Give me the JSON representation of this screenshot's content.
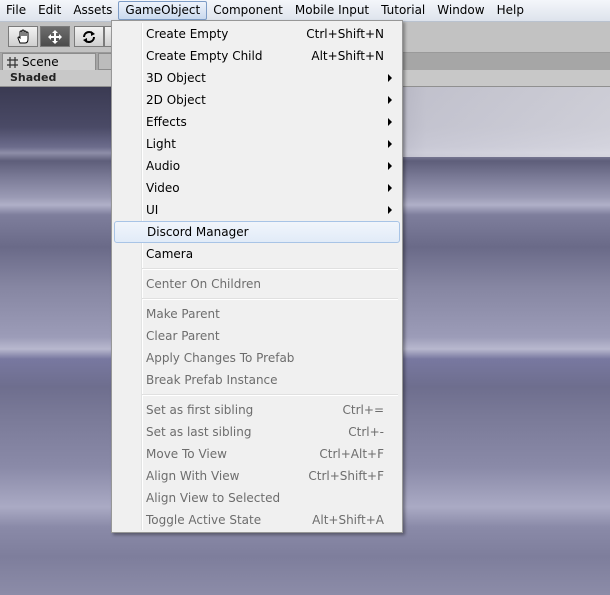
{
  "menubar": {
    "items": [
      "File",
      "Edit",
      "Assets",
      "GameObject",
      "Component",
      "Mobile Input",
      "Tutorial",
      "Window",
      "Help"
    ],
    "active": "GameObject"
  },
  "toolbar": {
    "tools": [
      "hand-icon",
      "move-icon",
      "rotate-icon"
    ]
  },
  "panel": {
    "tab_label": "Scene",
    "shading_mode": "Shaded"
  },
  "menu": {
    "groups": [
      [
        {
          "label": "Create Empty",
          "shortcut": "Ctrl+Shift+N",
          "submenu": false,
          "enabled": true
        },
        {
          "label": "Create Empty Child",
          "shortcut": "Alt+Shift+N",
          "submenu": false,
          "enabled": true
        },
        {
          "label": "3D Object",
          "shortcut": "",
          "submenu": true,
          "enabled": true
        },
        {
          "label": "2D Object",
          "shortcut": "",
          "submenu": true,
          "enabled": true
        },
        {
          "label": "Effects",
          "shortcut": "",
          "submenu": true,
          "enabled": true
        },
        {
          "label": "Light",
          "shortcut": "",
          "submenu": true,
          "enabled": true
        },
        {
          "label": "Audio",
          "shortcut": "",
          "submenu": true,
          "enabled": true
        },
        {
          "label": "Video",
          "shortcut": "",
          "submenu": true,
          "enabled": true
        },
        {
          "label": "UI",
          "shortcut": "",
          "submenu": true,
          "enabled": true
        },
        {
          "label": "Discord Manager",
          "shortcut": "",
          "submenu": false,
          "enabled": true,
          "highlighted": true
        },
        {
          "label": "Camera",
          "shortcut": "",
          "submenu": false,
          "enabled": true
        }
      ],
      [
        {
          "label": "Center On Children",
          "shortcut": "",
          "submenu": false,
          "enabled": false
        }
      ],
      [
        {
          "label": "Make Parent",
          "shortcut": "",
          "submenu": false,
          "enabled": false
        },
        {
          "label": "Clear Parent",
          "shortcut": "",
          "submenu": false,
          "enabled": false
        },
        {
          "label": "Apply Changes To Prefab",
          "shortcut": "",
          "submenu": false,
          "enabled": false
        },
        {
          "label": "Break Prefab Instance",
          "shortcut": "",
          "submenu": false,
          "enabled": false
        }
      ],
      [
        {
          "label": "Set as first sibling",
          "shortcut": "Ctrl+=",
          "submenu": false,
          "enabled": false
        },
        {
          "label": "Set as last sibling",
          "shortcut": "Ctrl+-",
          "submenu": false,
          "enabled": false
        },
        {
          "label": "Move To View",
          "shortcut": "Ctrl+Alt+F",
          "submenu": false,
          "enabled": false
        },
        {
          "label": "Align With View",
          "shortcut": "Ctrl+Shift+F",
          "submenu": false,
          "enabled": false
        },
        {
          "label": "Align View to Selected",
          "shortcut": "",
          "submenu": false,
          "enabled": false
        },
        {
          "label": "Toggle Active State",
          "shortcut": "Alt+Shift+A",
          "submenu": false,
          "enabled": false
        }
      ]
    ]
  }
}
